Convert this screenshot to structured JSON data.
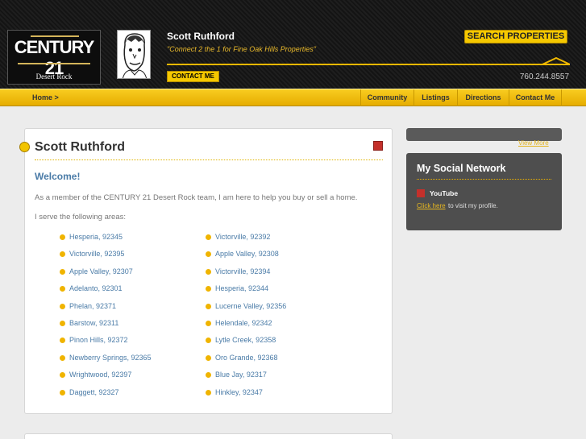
{
  "header": {
    "logo_text": "CENTURY 21",
    "logo_sub": "Desert Rock",
    "agent_name": "Scott Ruthford",
    "tagline": "\"Connect 2 the 1 for Fine Oak Hills Properties\"",
    "contact_label": "CONTACT ME",
    "search_label": "SEARCH PROPERTIES",
    "phone": "760.244.8557"
  },
  "nav": {
    "home": "Home >",
    "items": [
      "Community",
      "Listings",
      "Directions",
      "Contact Me"
    ]
  },
  "main": {
    "title": "Scott Ruthford",
    "welcome": "Welcome!",
    "intro": "As a member of the CENTURY 21 Desert Rock team, I am here to help you buy or sell a home.",
    "serve": "I serve the following areas:",
    "areas_left": [
      "Hesperia, 92345",
      "Victorville, 92395",
      "Apple Valley, 92307",
      "Adelanto, 92301",
      "Phelan, 92371",
      "Barstow, 92311",
      "Pinon Hills, 92372",
      "Newberry Springs, 92365",
      "Wrightwood, 92397",
      "Daggett, 92327"
    ],
    "areas_right": [
      "Victorville, 92392",
      "Apple Valley, 92308",
      "Victorville, 92394",
      "Hesperia, 92344",
      "Lucerne Valley, 92356",
      "Helendale, 92342",
      "Lytle Creek, 92358",
      "Oro Grande, 92368",
      "Blue Jay, 92317",
      "Hinkley, 92347"
    ]
  },
  "social": {
    "view_more": "View More",
    "title": "My Social Network",
    "youtube": "YouTube",
    "click_here": "Click here",
    "visit_text": "to visit my profile."
  },
  "colors": {
    "accent": "#f5c800",
    "link": "#4a7ba7"
  },
  "icons": [
    "youtube-icon",
    "bullet-icon",
    "roof-icon"
  ]
}
